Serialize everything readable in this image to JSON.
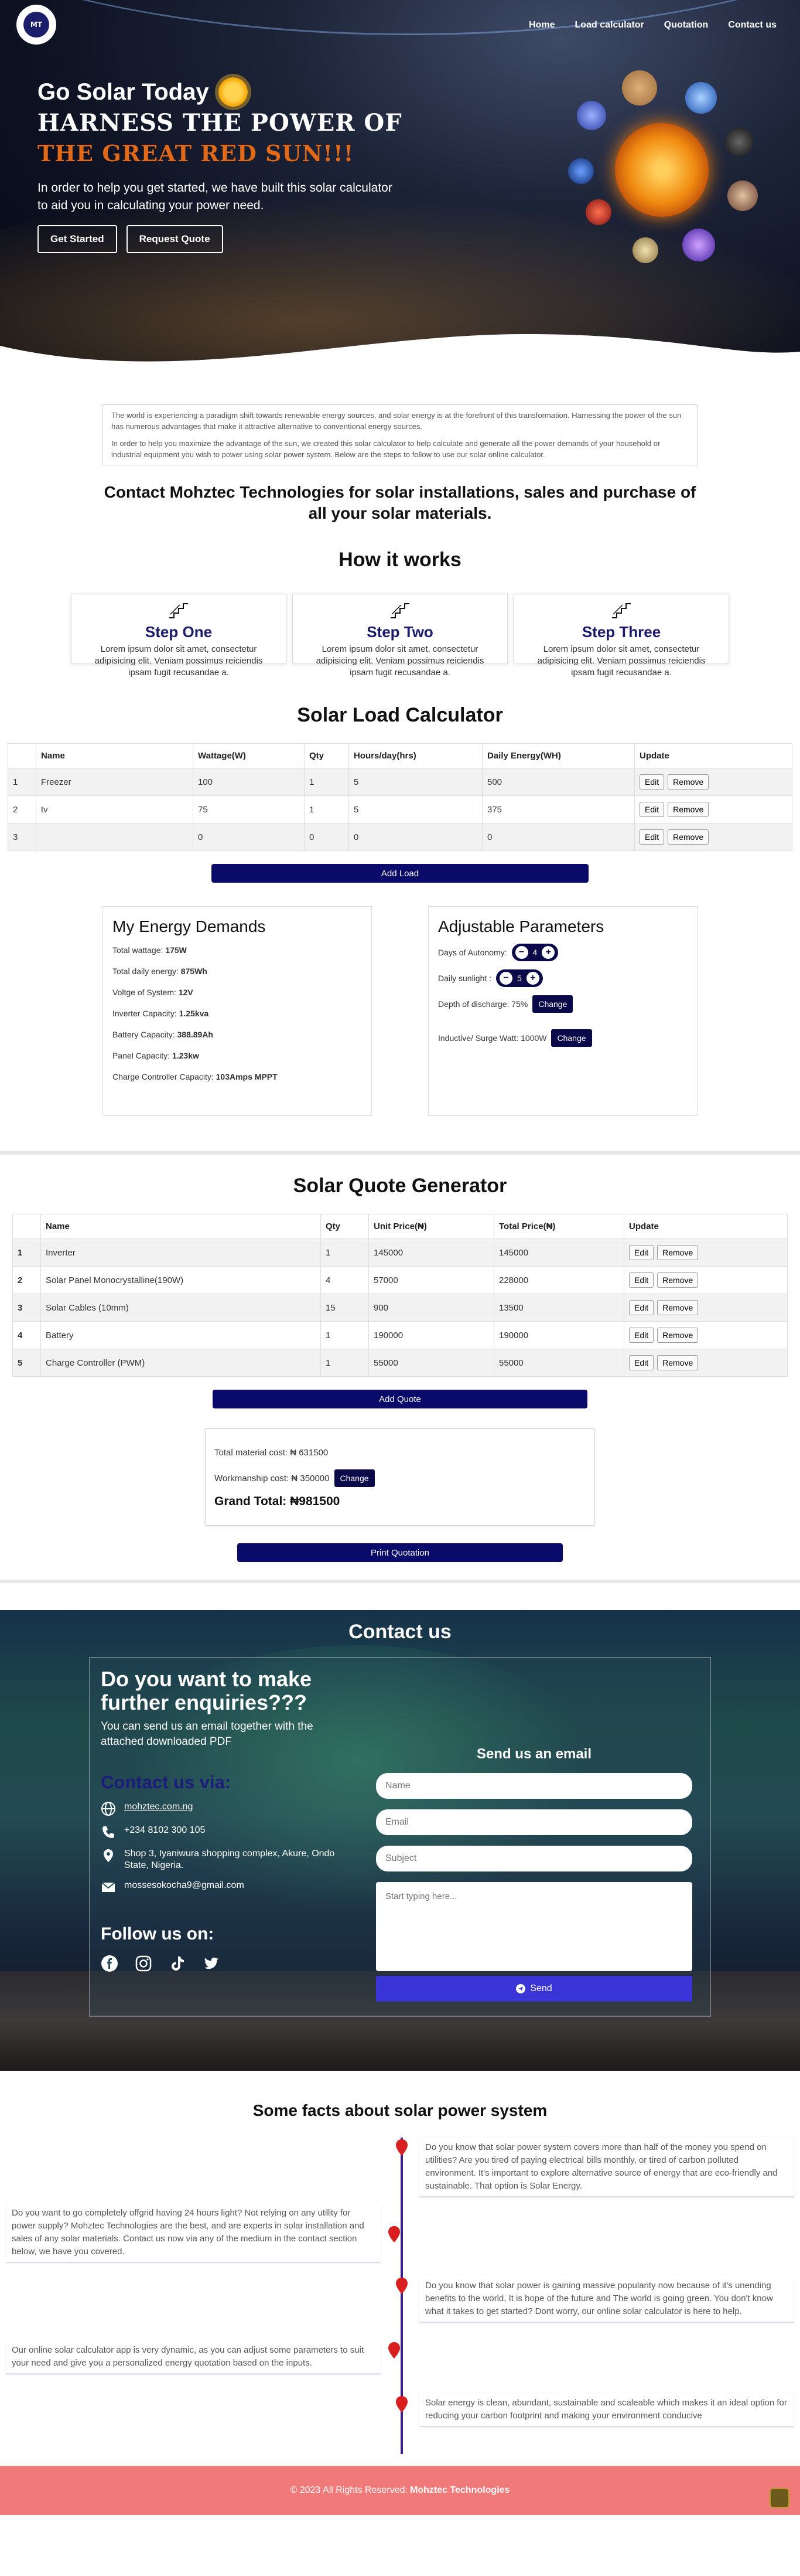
{
  "nav": {
    "logo_text": "MT",
    "items": [
      "Home",
      "Load calculator",
      "Quotation",
      "Contact us"
    ]
  },
  "hero": {
    "go": "Go Solar Today",
    "harness": "HARNESS THE POWER OF",
    "red_sun": "THE GREAT RED SUN!!!",
    "intro": "In order to help you get started, we have built this solar calculator to aid you in calculating your power need.",
    "btn_start": "Get Started",
    "btn_quote": "Request Quote"
  },
  "info": {
    "p1": "The world is experiencing a paradigm shift towards renewable energy sources, and solar energy is at the forefront of this transformation. Harnessing the power of the sun has numerous advantages that make it attractive alternative to conventional energy sources.",
    "p2": "In order to help you maximize the advantage of the sun, we created this solar calculator to help calculate and generate all the power demands of your household or industrial equipment you wish to power using solar power system. Below are the steps to follow to use our solar online calculator."
  },
  "contact_line": "Contact Mohztec Technologies for solar installations, sales and purchase of all your solar materials.",
  "how": {
    "title": "How it works",
    "steps": [
      {
        "title": "Step One",
        "text": "Lorem ipsum dolor sit amet, consectetur adipisicing elit. Veniam possimus reiciendis ipsam fugit recusandae a."
      },
      {
        "title": "Step Two",
        "text": "Lorem ipsum dolor sit amet, consectetur adipisicing elit. Veniam possimus reiciendis ipsam fugit recusandae a."
      },
      {
        "title": "Step Three",
        "text": "Lorem ipsum dolor sit amet, consectetur adipisicing elit. Veniam possimus reiciendis ipsam fugit recusandae a."
      }
    ]
  },
  "load": {
    "title": "Solar Load Calculator",
    "headers": [
      "",
      "Name",
      "Wattage(W)",
      "Qty",
      "Hours/day(hrs)",
      "Daily Energy(WH)",
      "Update"
    ],
    "rows": [
      [
        "1",
        "Freezer",
        "100",
        "1",
        "5",
        "500"
      ],
      [
        "2",
        "tv",
        "75",
        "1",
        "5",
        "375"
      ],
      [
        "3",
        "",
        "0",
        "0",
        "0",
        "0"
      ]
    ],
    "edit": "Edit",
    "remove": "Remove",
    "add_btn": "Add Load"
  },
  "energy": {
    "title": "My Energy Demands",
    "lines": [
      {
        "label": "Total wattage:",
        "value": "175W"
      },
      {
        "label": "Total daily energy:",
        "value": "875Wh"
      },
      {
        "label": "Voltge of System:",
        "value": "12V"
      },
      {
        "label": "Inverter Capacity:",
        "value": "1.25kva"
      },
      {
        "label": "Battery Capacity:",
        "value": "388.89Ah"
      },
      {
        "label": "Panel Capacity:",
        "value": "1.23kw"
      },
      {
        "label": "Charge Controller Capacity:",
        "value": "103Amps MPPT"
      }
    ]
  },
  "params": {
    "title": "Adjustable Parameters",
    "autonomy_label": "Days of Autonomy:",
    "autonomy": "4",
    "sunlight_label": "Daily sunlight :",
    "sunlight": "5",
    "discharge_label": "Depth of discharge: 75%",
    "surge_label": "Inductive/ Surge Watt: 1000W",
    "change": "Change",
    "minus": "−",
    "plus": "+"
  },
  "quote": {
    "title": "Solar Quote Generator",
    "headers": [
      "",
      "Name",
      "Qty",
      "Unit Price(₦)",
      "Total Price(₦)",
      "Update"
    ],
    "rows": [
      [
        "1",
        "Inverter",
        "1",
        "145000",
        "145000"
      ],
      [
        "2",
        "Solar Panel Monocrystalline(190W)",
        "4",
        "57000",
        "228000"
      ],
      [
        "3",
        "Solar Cables (10mm)",
        "15",
        "900",
        "13500"
      ],
      [
        "4",
        "Battery",
        "1",
        "190000",
        "190000"
      ],
      [
        "5",
        "Charge Controller (PWM)",
        "1",
        "55000",
        "55000"
      ]
    ],
    "add_btn": "Add Quote",
    "material": "Total material cost: ₦ 631500",
    "workmanship": "Workmanship cost: ₦ 350000",
    "change": "Change",
    "grand": "Grand Total: ₦981500",
    "print": "Print Quotation"
  },
  "contact": {
    "title": "Contact us",
    "heading": "Do you want to make further enquiries???",
    "sub": "You can send us an email together with the attached downloaded PDF",
    "via": "Contact us via:",
    "web": "mohztec.com.ng",
    "phone": "+234 8102 300 105",
    "address": "Shop 3, Iyaniwura shopping complex, Akure, Ondo State, Nigeria.",
    "email": "mossesokocha9@gmail.com",
    "follow": "Follow us on:",
    "form_title": "Send us an email",
    "name_ph": "Name",
    "email_ph": "Email",
    "subject_ph": "Subject",
    "msg_ph": "Start typing here...",
    "send": "Send"
  },
  "facts": {
    "title": "Some facts about solar power system",
    "items": [
      "Do you know that solar power system covers more than half of the money you spend on utilities? Are you tired of paying electrical bills monthly, or tired of carbon polluted environment. It's important to explore alternative source of energy that are eco-friendly and sustainable. That option is Solar Energy.",
      "Do you want to go completely offgrid having 24 hours light? Not relying on any utility for power supply? Mohztec Technologies are the best, and are experts in solar installation and sales of any solar materials. Contact us now via any of the medium in the contact section below, we have you covered.",
      "Do you know that solar power is gaining massive popularity now because of it's unending benefits to the world, It is hope of the future and The world is going green. You don't know what it takes to get started? Dont worry, our online solar calculator is here to help.",
      "Our online solar calculator app is very dynamic, as you can adjust some parameters to suit your need and give you a personalized energy quotation based on the inputs.",
      "Solar energy is clean, abundant, sustainable and scaleable which makes it an ideal option for reducing your carbon footprint and making your environment conducive"
    ]
  },
  "footer": {
    "text": "© 2023 All Rights Reserved:",
    "brand": "Mohztec Technologies"
  },
  "colors": {
    "navy": "#0a0a6b",
    "footer": "#f0797a",
    "send": "#3a35d6",
    "pin": "#d82020"
  }
}
